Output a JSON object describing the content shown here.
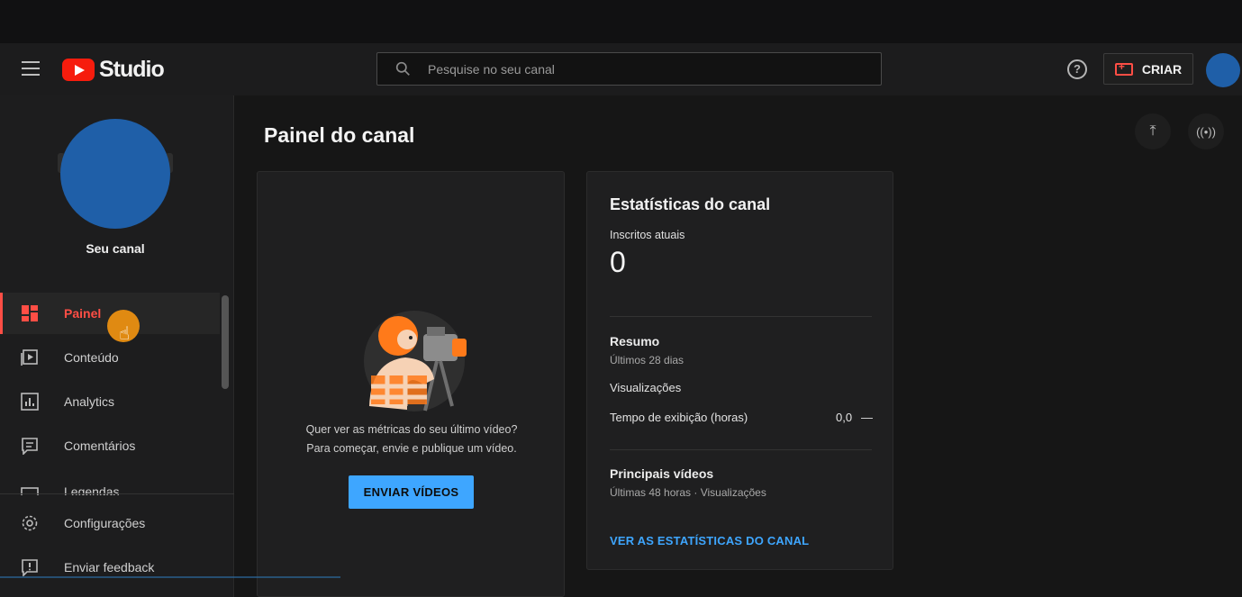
{
  "app": {
    "logo_text": "Studio",
    "brand_color": "#f61c0d",
    "accent_color": "#3ea6ff",
    "active_color": "#ff4e45"
  },
  "header": {
    "search_placeholder": "Pesquise no seu canal",
    "create_label": "CRIAR",
    "help_glyph": "?"
  },
  "sidebar": {
    "channel_name": "Seu canal",
    "items": [
      {
        "label": "Painel",
        "icon": "dashboard-icon",
        "active": true
      },
      {
        "label": "Conteúdo",
        "icon": "content-icon"
      },
      {
        "label": "Analytics",
        "icon": "analytics-icon"
      },
      {
        "label": "Comentários",
        "icon": "comments-icon"
      },
      {
        "label": "Legendas",
        "icon": "subtitles-icon"
      }
    ],
    "bottom_items": [
      {
        "label": "Configurações",
        "icon": "gear-icon"
      },
      {
        "label": "Enviar feedback",
        "icon": "feedback-icon"
      }
    ]
  },
  "main": {
    "title": "Painel do canal",
    "video_card": {
      "message_line1": "Quer ver as métricas do seu último vídeo?",
      "message_line2": "Para começar, envie e publique um vídeo.",
      "button_label": "ENVIAR VÍDEOS"
    },
    "stats_card": {
      "title": "Estatísticas do canal",
      "subs_label": "Inscritos atuais",
      "subs_value": "0",
      "summary_title": "Resumo",
      "summary_sub": "Últimos 28 dias",
      "views_label": "Visualizações",
      "watch_time_label": "Tempo de exibição (horas)",
      "watch_time_value": "0,0",
      "watch_time_trend": "—",
      "top_videos_title": "Principais vídeos",
      "top_videos_sub": "Últimas 48 horas · Visualizações",
      "link_label": "VER AS ESTATÍSTICAS DO CANAL"
    }
  }
}
